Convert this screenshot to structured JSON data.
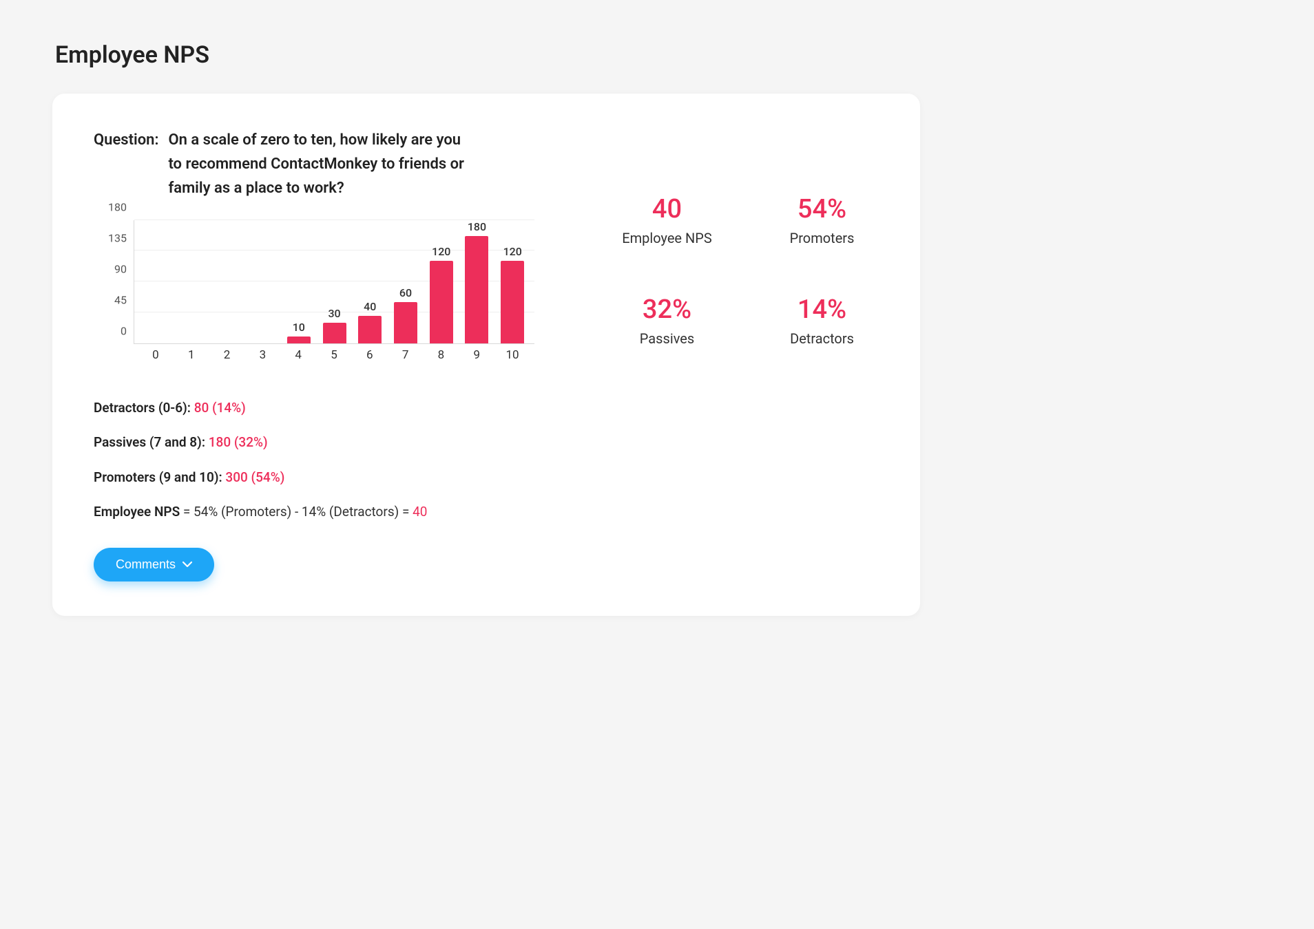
{
  "page_title": "Employee NPS",
  "card": {
    "question_label": "Question:",
    "question_text": "On a scale of zero to ten, how likely are you to recommend ContactMonkey to friends or family as a place to work?",
    "breakdown": {
      "detractors_label": "Detractors (0-6): ",
      "detractors_value": "80 (14%)",
      "passives_label": "Passives (7 and 8): ",
      "passives_value": "180 (32%)",
      "promoters_label": "Promoters (9 and 10): ",
      "promoters_value": "300 (54%)",
      "formula_lhs": "Employee NPS",
      "formula_mid": " = 54% (Promoters) - 14% (Detractors) = ",
      "formula_result": "40"
    },
    "comments_button": "Comments"
  },
  "stats": [
    {
      "value": "40",
      "label": "Employee NPS"
    },
    {
      "value": "54%",
      "label": "Promoters"
    },
    {
      "value": "32%",
      "label": "Passives"
    },
    {
      "value": "14%",
      "label": "Detractors"
    }
  ],
  "chart_data": {
    "type": "bar",
    "categories": [
      "0",
      "1",
      "2",
      "3",
      "4",
      "5",
      "6",
      "7",
      "8",
      "9",
      "10"
    ],
    "values": [
      0,
      0,
      0,
      0,
      10,
      30,
      40,
      60,
      120,
      180,
      120
    ],
    "title": "",
    "xlabel": "",
    "ylabel": "",
    "ylim": [
      0,
      180
    ],
    "y_ticks": [
      0,
      45,
      90,
      135,
      180
    ],
    "bar_color": "#ed2e5a"
  }
}
